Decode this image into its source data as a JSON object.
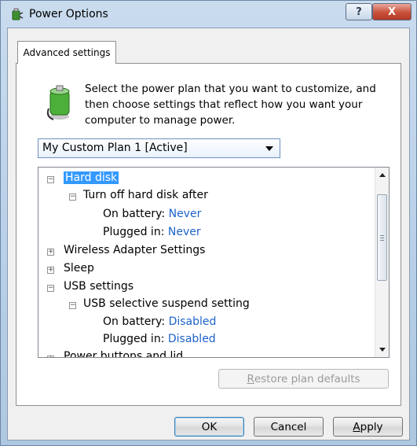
{
  "window": {
    "title": "Power Options",
    "help_label": "?",
    "close_label": "X"
  },
  "tab": {
    "label": "Advanced settings"
  },
  "description": "Select the power plan that you want to customize, and then choose settings that reflect how you want your computer to manage power.",
  "plan_select": {
    "value": "My Custom Plan 1 [Active]"
  },
  "tree": {
    "hard_disk": "Hard disk",
    "turn_off": "Turn off hard disk after",
    "on_battery_label": "On battery:",
    "on_battery_value": "Never",
    "plugged_in_label": "Plugged in:",
    "plugged_in_value": "Never",
    "wireless": "Wireless Adapter Settings",
    "sleep": "Sleep",
    "usb": "USB settings",
    "usb_suspend": "USB selective suspend setting",
    "usb_on_battery_label": "On battery:",
    "usb_on_battery_value": "Disabled",
    "usb_plugged_in_label": "Plugged in:",
    "usb_plugged_in_value": "Disabled",
    "power_buttons": "Power buttons and lid"
  },
  "buttons": {
    "restore_prefix": "",
    "restore_mnemonic": "R",
    "restore_rest": "estore plan defaults",
    "ok": "OK",
    "cancel": "Cancel",
    "apply_mnemonic": "A",
    "apply_rest": "pply"
  }
}
